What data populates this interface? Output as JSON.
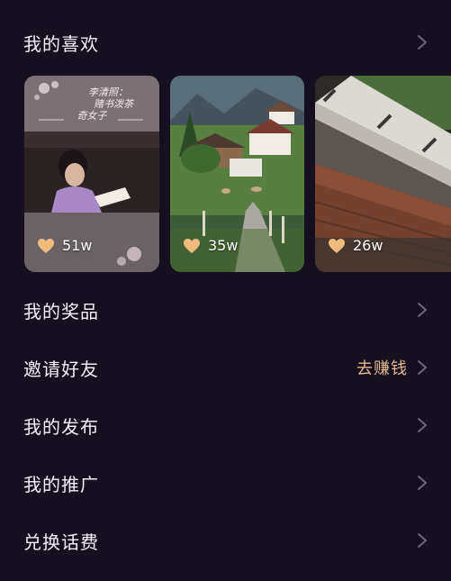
{
  "menu": {
    "likes_label": "我的喜欢",
    "items": [
      {
        "label": "我的奖品",
        "extra": ""
      },
      {
        "label": "邀请好友",
        "extra": "去赚钱"
      },
      {
        "label": "我的发布",
        "extra": ""
      },
      {
        "label": "我的推广",
        "extra": ""
      },
      {
        "label": "兑换话费",
        "extra": ""
      }
    ]
  },
  "liked_videos": [
    {
      "count": "51w",
      "scene": "drama-still-woman-reading",
      "caption": [
        "李清照：",
        "赌书泼茶",
        "奇女子"
      ]
    },
    {
      "count": "35w",
      "scene": "alpine-village-road"
    },
    {
      "count": "26w",
      "scene": "wooden-balcony"
    }
  ],
  "colors": {
    "background": "#150f1f",
    "accent": "#e2b98f",
    "heart": "#f2bb7e",
    "chevron": "#6d6677"
  }
}
